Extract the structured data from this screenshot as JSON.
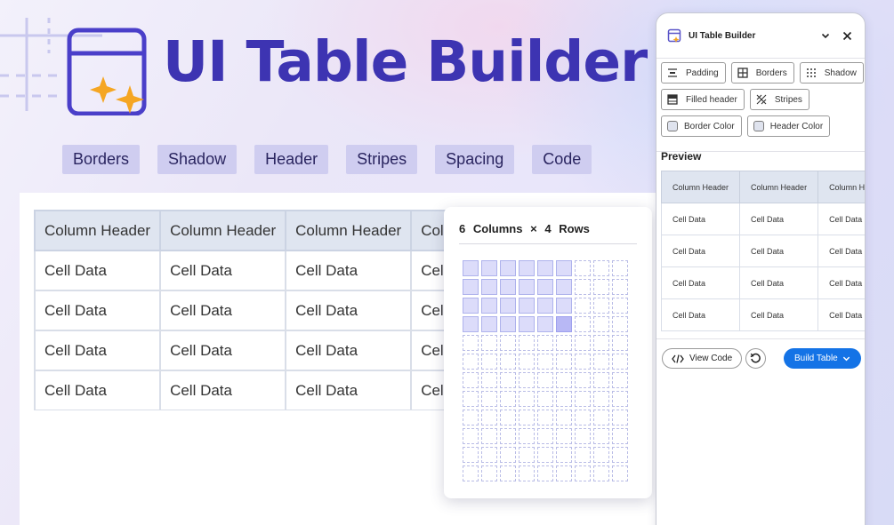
{
  "app": {
    "title": "UI Table Builder"
  },
  "tabs": [
    "Borders",
    "Shadow",
    "Header",
    "Stripes",
    "Spacing",
    "Code"
  ],
  "big_table": {
    "headers": [
      "Column Header",
      "Column Header",
      "Column Header",
      "Column Header"
    ],
    "rows": [
      [
        "Cell Data",
        "Cell Data",
        "Cell Data",
        "Cell Data"
      ],
      [
        "Cell Data",
        "Cell Data",
        "Cell Data",
        "Cell Data"
      ],
      [
        "Cell Data",
        "Cell Data",
        "Cell Data",
        "Cell Data"
      ],
      [
        "Cell Data",
        "Cell Data",
        "Cell Data",
        "Cell Data"
      ]
    ]
  },
  "picker": {
    "columns": "6",
    "columns_label": "Columns",
    "times": "×",
    "rows": "4",
    "rows_label": "Rows",
    "grid_cols": 9,
    "grid_rows": 12,
    "selected_cols": 6,
    "selected_rows": 4
  },
  "panel": {
    "title": "UI Table Builder",
    "options_row1": [
      {
        "label": "Padding",
        "icon": "padding-icon"
      },
      {
        "label": "Borders",
        "icon": "borders-icon"
      },
      {
        "label": "Shadow",
        "icon": "shadow-icon"
      }
    ],
    "options_row2": [
      {
        "label": "Filled header",
        "icon": "filled-header-icon"
      },
      {
        "label": "Stripes",
        "icon": "stripes-icon"
      }
    ],
    "options_row3": [
      {
        "label": "Border Color",
        "icon": "color-swatch"
      },
      {
        "label": "Header Color",
        "icon": "color-swatch"
      }
    ],
    "preview_label": "Preview",
    "preview_table": {
      "headers": [
        "Column Header",
        "Column Header",
        "Column Header"
      ],
      "rows": [
        [
          "Cell Data",
          "Cell Data",
          "Cell Data"
        ],
        [
          "Cell Data",
          "Cell Data",
          "Cell Data"
        ],
        [
          "Cell Data",
          "Cell Data",
          "Cell Data"
        ],
        [
          "Cell Data",
          "Cell Data",
          "Cell Data"
        ]
      ]
    },
    "view_code_label": "View Code",
    "build_table_label": "Build Table"
  },
  "colors": {
    "brand": "#3d34b2",
    "accent": "#1473e6",
    "sparkle": "#f5a623",
    "tab_bg": "#cfcdf0",
    "header_bg": "#dfe5f0"
  }
}
